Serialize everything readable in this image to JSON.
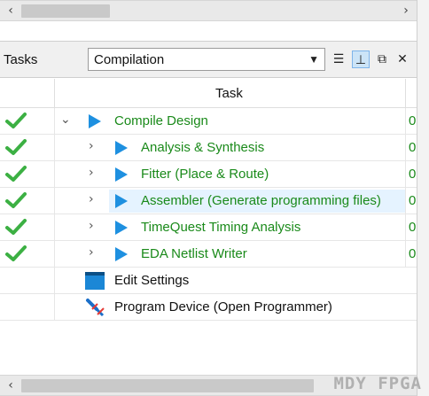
{
  "top_scroll": {
    "left_arrow": "‹",
    "right_arrow": "›"
  },
  "tasks_panel": {
    "title": "Tasks",
    "flow_value": "Compilation",
    "dropdown_glyph": "▼",
    "icons": [
      "list-icon",
      "pin-icon",
      "float-window-icon",
      "close-icon"
    ]
  },
  "table": {
    "header_task": "Task",
    "rows": [
      {
        "label": "Compile Design",
        "status": "done",
        "level": 0,
        "expanded": true,
        "stub": "0"
      },
      {
        "label": "Analysis & Synthesis",
        "status": "done",
        "level": 1,
        "expanded": false,
        "stub": "0"
      },
      {
        "label": "Fitter (Place & Route)",
        "status": "done",
        "level": 1,
        "expanded": false,
        "stub": "0"
      },
      {
        "label": "Assembler (Generate programming files)",
        "status": "done",
        "level": 1,
        "expanded": false,
        "stub": "0",
        "highlight": true
      },
      {
        "label": "TimeQuest Timing Analysis",
        "status": "done",
        "level": 1,
        "expanded": false,
        "stub": "0"
      },
      {
        "label": "EDA Netlist Writer",
        "status": "done",
        "level": 1,
        "expanded": false,
        "stub": "0"
      },
      {
        "label": "Edit Settings",
        "status": "none",
        "icon": "settings-icon"
      },
      {
        "label": "Program Device (Open Programmer)",
        "status": "none",
        "icon": "programmer-icon"
      }
    ]
  },
  "bottom_scroll": {
    "left_arrow": "‹"
  },
  "watermark": "MDY FPGA",
  "colors": {
    "check_green": "#3cb043",
    "label_green": "#1a8a1a",
    "play_blue": "#1e90e0",
    "highlight": "#e5f3ff"
  }
}
